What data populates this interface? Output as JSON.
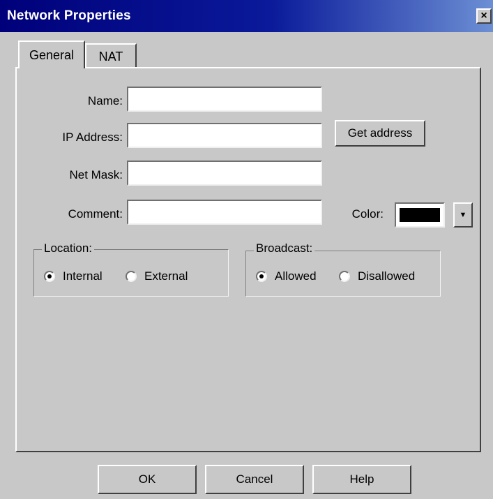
{
  "window": {
    "title": "Network Properties",
    "close_glyph": "×"
  },
  "tabs": [
    {
      "label": "General",
      "selected": true
    },
    {
      "label": "NAT",
      "selected": false
    }
  ],
  "fields": {
    "name": {
      "label": "Name:",
      "value": ""
    },
    "ip_address": {
      "label": "IP Address:",
      "value": ""
    },
    "net_mask": {
      "label": "Net Mask:",
      "value": ""
    },
    "comment": {
      "label": "Comment:",
      "value": ""
    }
  },
  "get_address_label": "Get address",
  "color": {
    "label": "Color:",
    "value": "#000000",
    "dropdown_icon": "▼"
  },
  "location": {
    "title": "Location:",
    "options": [
      {
        "label": "Internal",
        "checked": true
      },
      {
        "label": "External",
        "checked": false
      }
    ]
  },
  "broadcast": {
    "title": "Broadcast:",
    "options": [
      {
        "label": "Allowed",
        "checked": true
      },
      {
        "label": "Disallowed",
        "checked": false
      }
    ]
  },
  "buttons": {
    "ok": "OK",
    "cancel": "Cancel",
    "help": "Help"
  }
}
